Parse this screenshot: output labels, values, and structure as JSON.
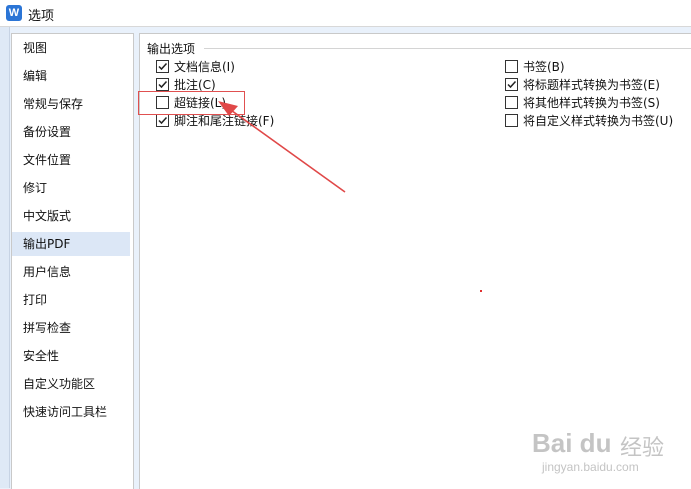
{
  "window": {
    "title": "选项",
    "app_icon_letter": "W"
  },
  "nav": {
    "items": [
      {
        "label": "视图"
      },
      {
        "label": "编辑"
      },
      {
        "label": "常规与保存"
      },
      {
        "label": "备份设置"
      },
      {
        "label": "文件位置"
      },
      {
        "label": "修订"
      },
      {
        "label": "中文版式"
      },
      {
        "label": "输出PDF",
        "selected": true
      },
      {
        "label": "用户信息"
      },
      {
        "label": "打印"
      },
      {
        "label": "拼写检查"
      },
      {
        "label": "安全性"
      },
      {
        "label": "自定义功能区"
      },
      {
        "label": "快速访问工具栏"
      }
    ]
  },
  "output_options": {
    "group_title": "输出选项",
    "left": [
      {
        "label": "文档信息(I)",
        "checked": true
      },
      {
        "label": "批注(C)",
        "checked": true
      },
      {
        "label": "超链接(L)",
        "checked": false
      },
      {
        "label": "脚注和尾注链接(F)",
        "checked": true
      }
    ],
    "right": [
      {
        "label": "书签(B)",
        "checked": false
      },
      {
        "label": "将标题样式转换为书签(E)",
        "checked": true
      },
      {
        "label": "将其他样式转换为书签(S)",
        "checked": false
      },
      {
        "label": "将自定义样式转换为书签(U)",
        "checked": false
      }
    ]
  },
  "annotation": {
    "highlight_color": "#e05050",
    "arrow_color": "#e04848"
  },
  "watermark": {
    "logo": "Bai du",
    "cn": "经验",
    "url": "jingyan.baidu.com"
  },
  "colors": {
    "selected_nav_bg": "#dce7f6",
    "accent": "#2b75d6"
  }
}
